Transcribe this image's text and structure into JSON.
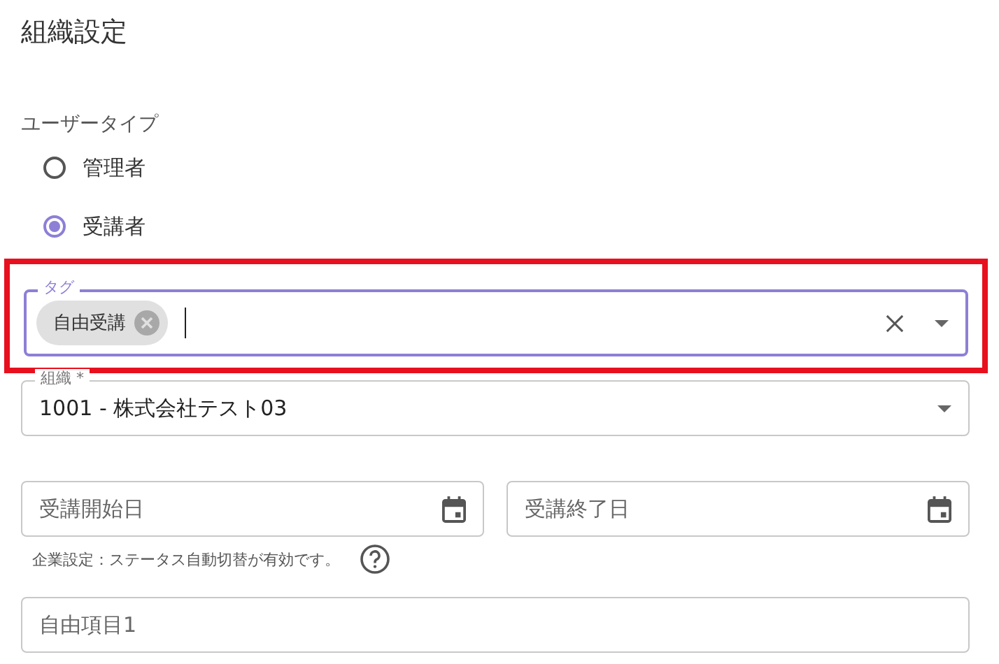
{
  "title": "組織設定",
  "user_type": {
    "label": "ユーザータイプ",
    "options": [
      {
        "label": "管理者",
        "selected": false
      },
      {
        "label": "受講者",
        "selected": true
      }
    ]
  },
  "tag_field": {
    "label": "タグ",
    "highlighted": true,
    "focused": true,
    "chips": [
      {
        "label": "自由受講"
      }
    ]
  },
  "organization": {
    "label": "組織 *",
    "value": "1001 - 株式会社テスト03"
  },
  "dates": [
    {
      "placeholder": "受講開始日"
    },
    {
      "placeholder": "受講終了日"
    }
  ],
  "note": "企業設定：ステータス自動切替が有効です。",
  "free_item": {
    "placeholder": "自由項目1"
  }
}
